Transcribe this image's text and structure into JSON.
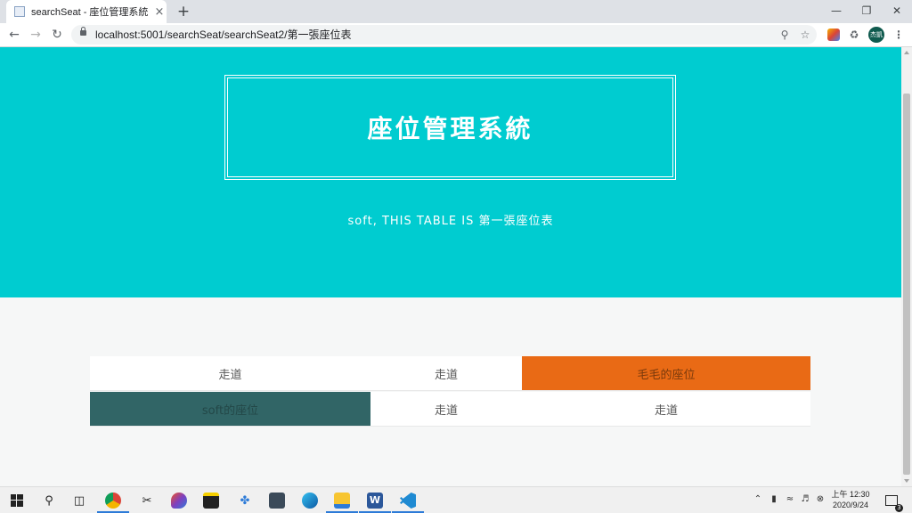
{
  "browser": {
    "tab_title": "searchSeat - 座位管理系統",
    "tab_close": "×",
    "new_tab": "+",
    "url": "localhost:5001/searchSeat/searchSeat2/第一張座位表",
    "profile_initials": "杰凱"
  },
  "page": {
    "site_title": "座位管理系統",
    "subtitle": "soft, THIS TABLE IS 第一張座位表",
    "hero_color": "#00ccd0"
  },
  "seat_table": {
    "rows": [
      [
        {
          "label": "走道",
          "type": "aisle"
        },
        {
          "label": "走道",
          "type": "aisle"
        },
        {
          "label": "毛毛的座位",
          "type": "seat",
          "color": "#e96a15"
        }
      ],
      [
        {
          "label": "soft的座位",
          "type": "seat",
          "color": "#316566"
        },
        {
          "label": "走道",
          "type": "aisle"
        },
        {
          "label": "走道",
          "type": "aisle"
        }
      ]
    ]
  },
  "taskbar": {
    "time": "上午 12:30",
    "date": "2020/9/24",
    "notification_count": "3"
  }
}
